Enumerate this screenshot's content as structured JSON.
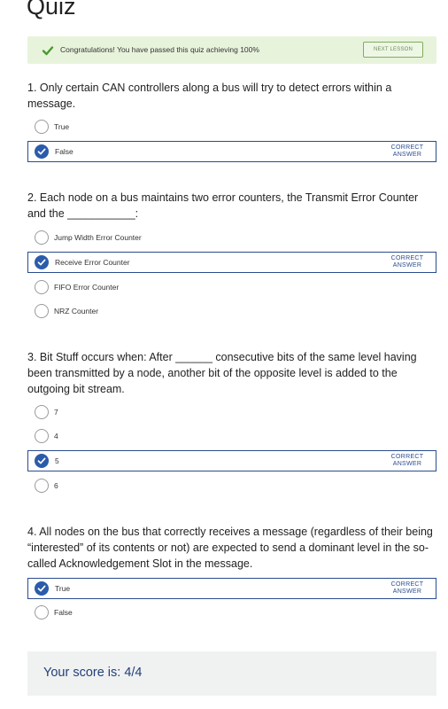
{
  "page_title": "Quiz",
  "banner": {
    "message": "Congratulations! You have passed this quiz achieving 100%",
    "next_button": "NEXT LESSON"
  },
  "badge_text": "CORRECT ANSWER",
  "questions": [
    {
      "text": "1. Only certain CAN controllers along a bus will try to detect errors within a message.",
      "options": [
        {
          "label": "True",
          "selected": false
        },
        {
          "label": "False",
          "selected": true
        }
      ]
    },
    {
      "text": "2. Each node on a bus maintains two error counters, the Transmit Error Counter and the ___________:",
      "options": [
        {
          "label": "Jump Width Error Counter",
          "selected": false
        },
        {
          "label": "Receive Error Counter",
          "selected": true
        },
        {
          "label": "FIFO Error Counter",
          "selected": false
        },
        {
          "label": "NRZ Counter",
          "selected": false
        }
      ]
    },
    {
      "text": "3. Bit Stuff occurs when: After ______ consecutive bits of the same level having been transmitted by a node, another bit of the opposite level is added to the outgoing bit stream.",
      "options": [
        {
          "label": "7",
          "selected": false
        },
        {
          "label": "4",
          "selected": false
        },
        {
          "label": "5",
          "selected": true
        },
        {
          "label": "6",
          "selected": false
        }
      ]
    },
    {
      "text": "4. All nodes on the bus that correctly receives a message (regardless of their being “interested” of its contents or not) are expected to send a dominant level in the so-called Acknowledgement Slot in the message.",
      "options": [
        {
          "label": "True",
          "selected": true
        },
        {
          "label": "False",
          "selected": false
        }
      ]
    }
  ],
  "score_text": "Your score is: 4/4"
}
